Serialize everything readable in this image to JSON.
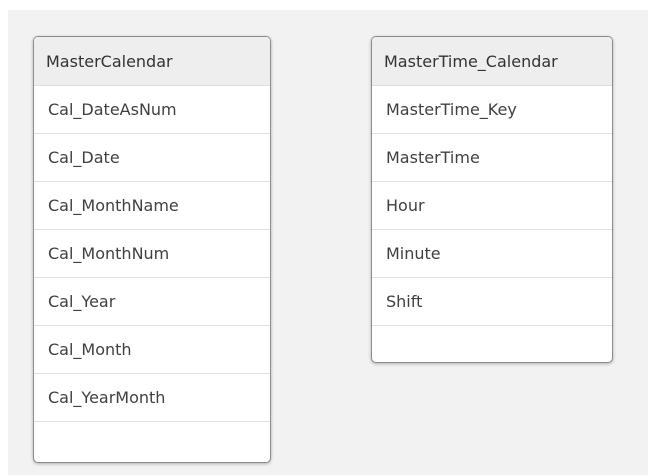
{
  "tables": [
    {
      "name": "MasterCalendar",
      "fields": [
        "Cal_DateAsNum",
        "Cal_Date",
        "Cal_MonthName",
        "Cal_MonthNum",
        "Cal_Year",
        "Cal_Month",
        "Cal_YearMonth"
      ]
    },
    {
      "name": "MasterTime_Calendar",
      "fields": [
        "MasterTime_Key",
        "MasterTime",
        "Hour",
        "Minute",
        "Shift"
      ]
    }
  ]
}
